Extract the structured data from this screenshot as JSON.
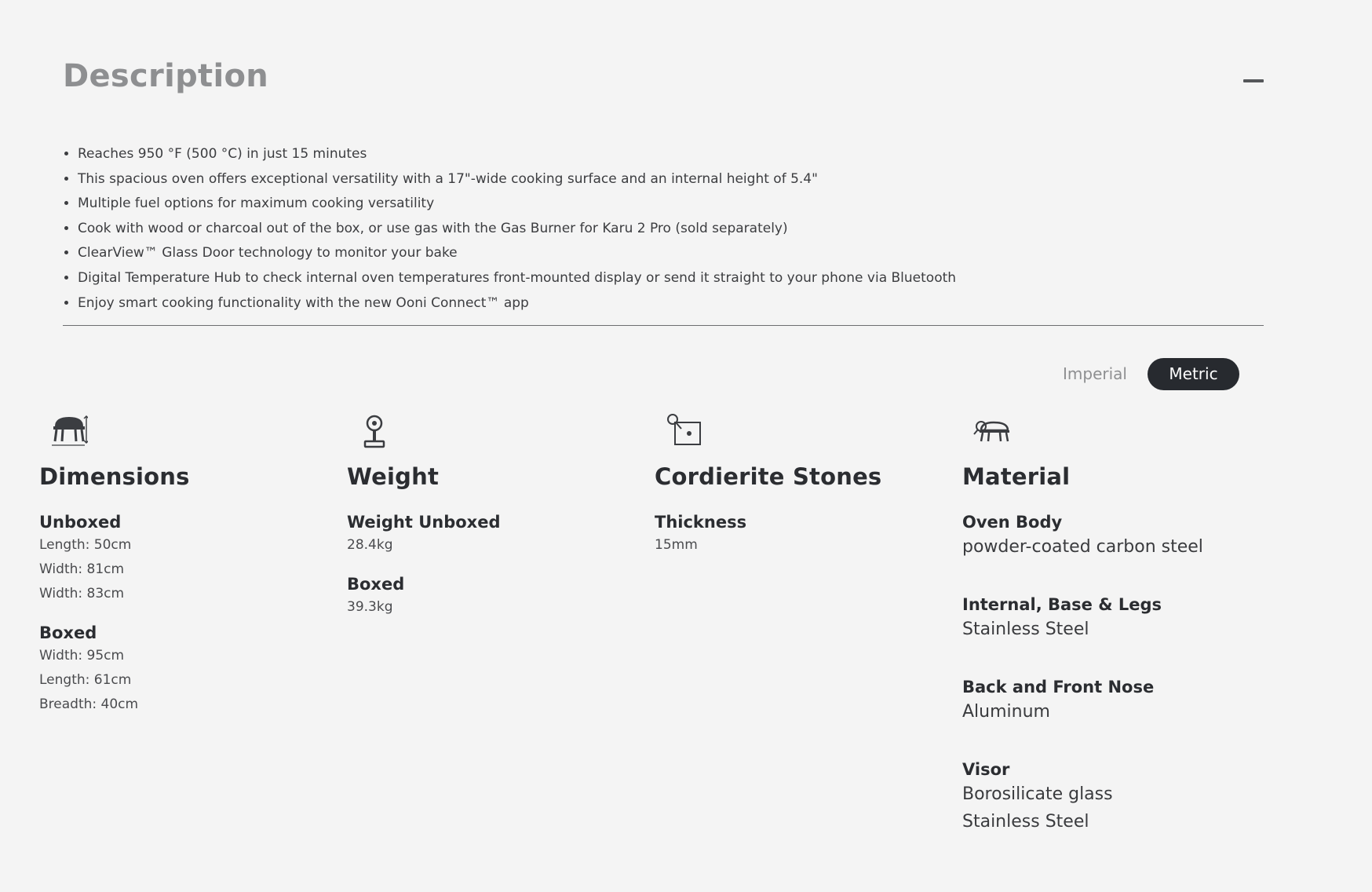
{
  "description": {
    "title": "Description",
    "bullets": [
      "Reaches 950 °F (500 °C) in just 15 minutes",
      "This spacious oven offers exceptional versatility with a 17\"-wide cooking surface and an internal height of 5.4\"",
      "Multiple fuel options for maximum cooking versatility",
      "Cook with wood or charcoal out of the box, or use gas with the Gas Burner for Karu 2 Pro (sold separately)",
      "ClearView™ Glass Door technology to monitor your bake",
      "Digital Temperature Hub to check internal oven temperatures front-mounted display or send it straight to your phone via Bluetooth",
      "Enjoy smart cooking functionality with the new Ooni Connect™ app"
    ]
  },
  "units": {
    "imperial": "Imperial",
    "metric": "Metric",
    "selected": "Metric"
  },
  "dimensions": {
    "title": "Dimensions",
    "icon": "oven-dimensions-icon",
    "unboxed_label": "Unboxed",
    "unboxed": [
      "Length: 50cm",
      "Width: 81cm",
      "Width: 83cm"
    ],
    "boxed_label": "Boxed",
    "boxed": [
      "Width: 95cm",
      "Length: 61cm",
      "Breadth: 40cm"
    ]
  },
  "weight": {
    "title": "Weight",
    "icon": "scale-icon",
    "unboxed_label": "Weight Unboxed",
    "unboxed": "28.4kg",
    "boxed_label": "Boxed",
    "boxed": "39.3kg"
  },
  "stones": {
    "title": "Cordierite Stones",
    "icon": "stone-thickness-icon",
    "thickness_label": "Thickness",
    "thickness": "15mm"
  },
  "material": {
    "title": "Material",
    "icon": "oven-material-icon",
    "items": [
      {
        "label": "Oven Body",
        "values": [
          "powder-coated carbon steel"
        ]
      },
      {
        "label": "Internal, Base & Legs",
        "values": [
          "Stainless Steel"
        ]
      },
      {
        "label": "Back and Front Nose",
        "values": [
          "Aluminum"
        ]
      },
      {
        "label": "Visor",
        "values": [
          "Borosilicate glass",
          "Stainless Steel"
        ]
      }
    ]
  }
}
